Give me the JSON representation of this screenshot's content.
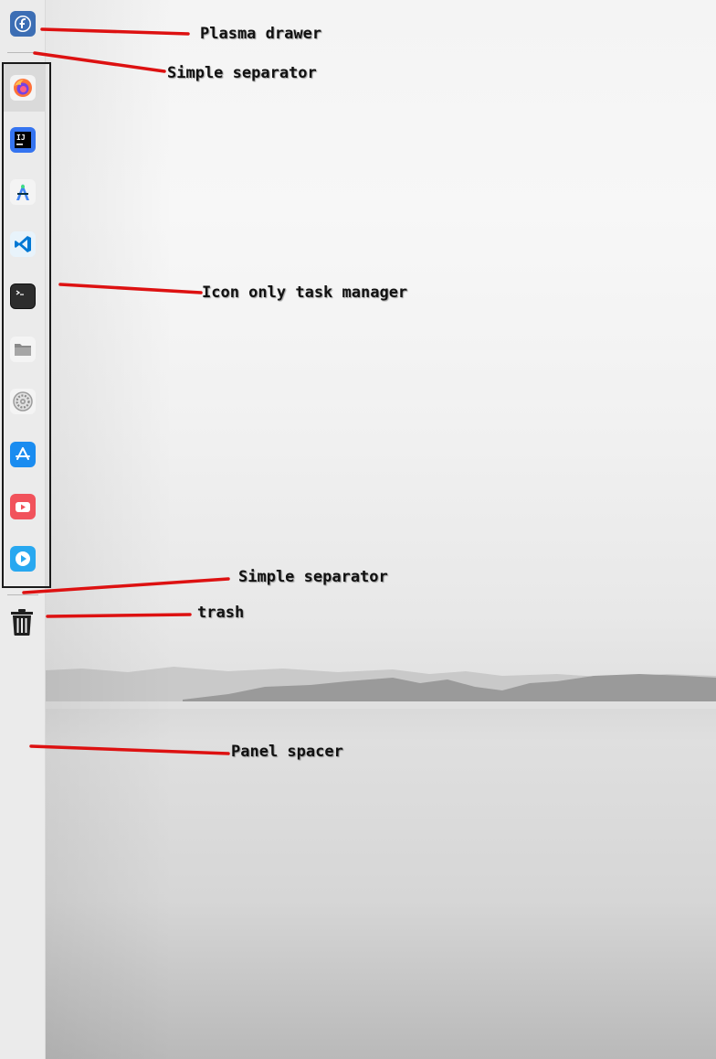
{
  "panel": {
    "drawer": {
      "icon": "fedora-icon",
      "color": "#3c6eb4"
    },
    "tasks": [
      {
        "icon": "firefox-icon"
      },
      {
        "icon": "intellij-icon"
      },
      {
        "icon": "android-studio-icon"
      },
      {
        "icon": "vscode-icon"
      },
      {
        "icon": "terminal-icon"
      },
      {
        "icon": "files-icon"
      },
      {
        "icon": "settings-icon"
      },
      {
        "icon": "app-store-icon"
      },
      {
        "icon": "youtube-icon"
      },
      {
        "icon": "media-player-icon"
      }
    ],
    "trash": {
      "icon": "trash-icon"
    }
  },
  "annotations": {
    "drawer": "Plasma drawer",
    "separator_top": "Simple separator",
    "task_manager": "Icon only task manager",
    "separator_bottom": "Simple separator",
    "trash": "trash",
    "spacer": "Panel spacer"
  },
  "colors": {
    "annotation_line": "#dd1111",
    "panel_bg": "#ebebeb"
  }
}
